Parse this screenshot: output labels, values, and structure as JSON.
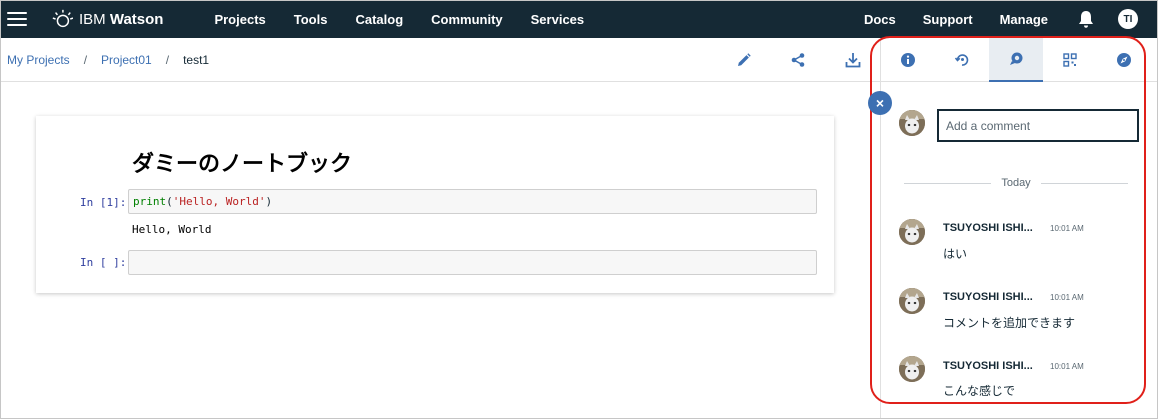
{
  "topbar": {
    "brand_prefix": "IBM",
    "brand_name": "Watson",
    "nav_left": [
      "Projects",
      "Tools",
      "Catalog",
      "Community",
      "Services"
    ],
    "nav_right": [
      "Docs",
      "Support",
      "Manage"
    ],
    "user_initials": "TI"
  },
  "breadcrumb": {
    "items": [
      "My Projects",
      "Project01"
    ],
    "separator": "/",
    "current": "test1"
  },
  "toolbar_icons": [
    "pencil-icon",
    "share-icon",
    "download-icon"
  ],
  "notebook": {
    "title": "ダミーのノートブック",
    "cells": [
      {
        "label": "In [1]:",
        "code_fn": "print",
        "code_arg": "'Hello, World'",
        "output": "Hello, World"
      },
      {
        "label": "In [ ]:",
        "code_fn": "",
        "code_arg": "",
        "output": ""
      }
    ]
  },
  "panel": {
    "tabs": [
      "info-icon",
      "version-icon",
      "comments-icon",
      "data-icon",
      "compass-icon"
    ],
    "active_tab": "comments-icon",
    "close_label": "×",
    "comment_placeholder": "Add a comment",
    "divider_label": "Today",
    "comments": [
      {
        "author": "TSUYOSHI ISHI...",
        "time": "10:01 AM",
        "text": "はい"
      },
      {
        "author": "TSUYOSHI ISHI...",
        "time": "10:01 AM",
        "text": "コメントを追加できます"
      },
      {
        "author": "TSUYOSHI ISHI...",
        "time": "10:01 AM",
        "text": "こんな感じで"
      }
    ]
  },
  "colors": {
    "topbar_bg": "#152935",
    "accent": "#3d70b2",
    "highlight": "#e0201a"
  }
}
